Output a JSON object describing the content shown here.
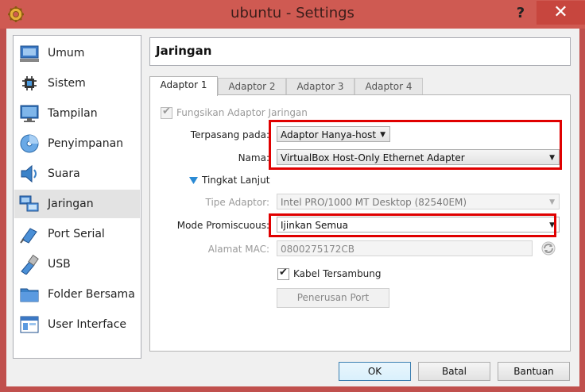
{
  "window": {
    "title": "ubuntu - Settings",
    "help": "?",
    "close": "✕"
  },
  "sidebar": {
    "items": [
      {
        "label": "Umum",
        "icon": "general-icon"
      },
      {
        "label": "Sistem",
        "icon": "system-chip-icon"
      },
      {
        "label": "Tampilan",
        "icon": "display-monitor-icon"
      },
      {
        "label": "Penyimpanan",
        "icon": "storage-disk-icon"
      },
      {
        "label": "Suara",
        "icon": "speaker-icon"
      },
      {
        "label": "Jaringan",
        "icon": "network-icon"
      },
      {
        "label": "Port Serial",
        "icon": "serial-port-icon"
      },
      {
        "label": "USB",
        "icon": "usb-icon"
      },
      {
        "label": "Folder Bersama",
        "icon": "folder-icon"
      },
      {
        "label": "User Interface",
        "icon": "user-interface-icon"
      }
    ],
    "active": "Jaringan"
  },
  "header": {
    "title": "Jaringan"
  },
  "tabs": [
    "Adaptor 1",
    "Adaptor 2",
    "Adaptor 3",
    "Adaptor 4"
  ],
  "adapter": {
    "enable_label": "Fungsikan Adaptor Jaringan",
    "attached_label": "Terpasang pada:",
    "attached_value": "Adaptor Hanya-host",
    "name_label": "Nama:",
    "name_value": "VirtualBox Host-Only Ethernet Adapter",
    "advanced_label": "Tingkat Lanjut",
    "type_label": "Tipe Adaptor:",
    "type_value": "Intel PRO/1000 MT Desktop (82540EM)",
    "promisc_label": "Mode Promiscuous:",
    "promisc_value": "Ijinkan Semua",
    "mac_label": "Alamat MAC:",
    "mac_value": "0800275172CB",
    "cable_label": "Kabel Tersambung",
    "port_forward_label": "Penerusan Port"
  },
  "footer": {
    "ok": "OK",
    "cancel": "Batal",
    "help": "Bantuan"
  },
  "colors": {
    "titlebar": "#cf5a52",
    "highlight": "#e00000",
    "close": "#c7463e"
  }
}
